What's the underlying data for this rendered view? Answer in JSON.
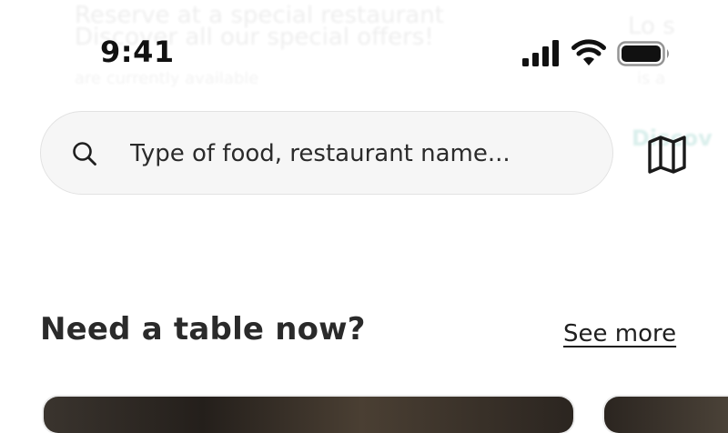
{
  "status_bar": {
    "time": "9:41",
    "signal_icon": "cellular-signal-icon",
    "wifi_icon": "wifi-icon",
    "battery_icon": "battery-icon"
  },
  "search": {
    "placeholder": "Type of food, restaurant name...",
    "icon": "search-icon"
  },
  "map_button": {
    "icon": "map-icon"
  },
  "section": {
    "title": "Need a table now?",
    "see_more_label": "See more"
  },
  "colors": {
    "text": "#1f1f1f",
    "search_bg": "#f6f6f6",
    "search_border": "#e2e2e2",
    "ghost_accent": "#1a9d8a"
  }
}
